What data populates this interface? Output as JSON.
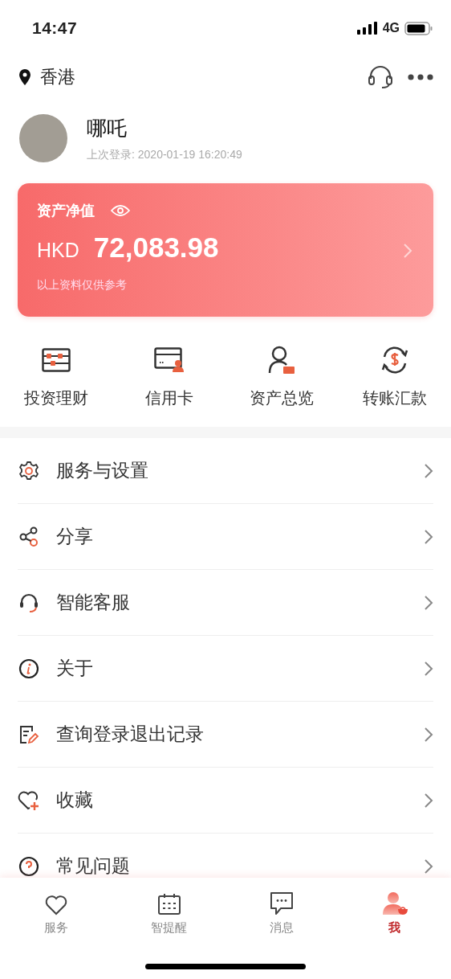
{
  "status_bar": {
    "time": "14:47",
    "network": "4G"
  },
  "header": {
    "location": "香港"
  },
  "profile": {
    "name": "哪吒",
    "last_login": "上次登录: 2020-01-19 16:20:49"
  },
  "asset_card": {
    "title": "资产净值",
    "currency": "HKD",
    "amount": "72,083.98",
    "note": "以上资料仅供参考"
  },
  "shortcuts": [
    {
      "label": "投资理财",
      "kind": "abacus"
    },
    {
      "label": "信用卡",
      "kind": "card"
    },
    {
      "label": "资产总览",
      "kind": "person"
    },
    {
      "label": "转账汇款",
      "kind": "transfer"
    }
  ],
  "menu": [
    {
      "label": "服务与设置",
      "kind": "gear"
    },
    {
      "label": "分享",
      "kind": "share"
    },
    {
      "label": "智能客服",
      "kind": "headset"
    },
    {
      "label": "关于",
      "kind": "info"
    },
    {
      "label": "查询登录退出记录",
      "kind": "record"
    },
    {
      "label": "收藏",
      "kind": "favorite"
    },
    {
      "label": "常见问题",
      "kind": "question"
    }
  ],
  "tab_bar": [
    {
      "label": "服务",
      "kind": "heart",
      "selected": false
    },
    {
      "label": "智提醒",
      "kind": "calendar",
      "selected": false
    },
    {
      "label": "消息",
      "kind": "chat",
      "selected": false
    },
    {
      "label": "我",
      "kind": "me",
      "selected": true
    }
  ]
}
